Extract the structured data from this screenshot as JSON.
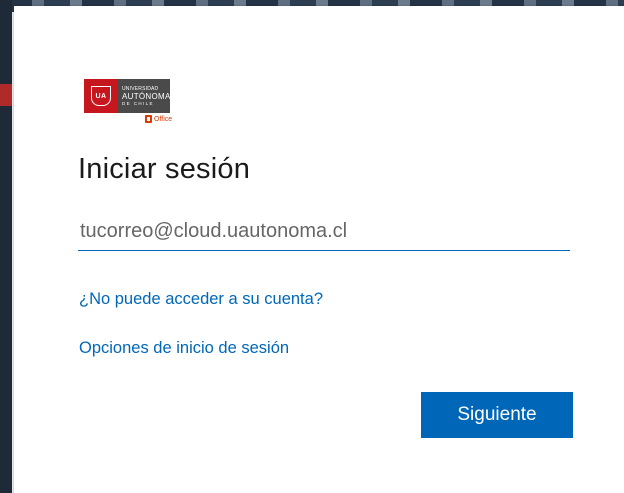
{
  "brand": {
    "crest_text": "UA",
    "line1": "UNIVERSIDAD",
    "line2": "AUTÓNOMA",
    "line3": "DE CHILE",
    "office_label": "Office",
    "red_color": "#c7171e",
    "dark_color": "#4a4a4a",
    "office_icon": "office-icon"
  },
  "signin": {
    "title": "Iniciar sesión",
    "email_placeholder": "tucorreo@cloud.uautonoma.cl",
    "email_value": "",
    "cant_access_link": "¿No puede acceder a su cuenta?",
    "signin_options_link": "Opciones de inicio de sesión",
    "next_button": "Siguiente",
    "accent_color": "#0067b8"
  }
}
